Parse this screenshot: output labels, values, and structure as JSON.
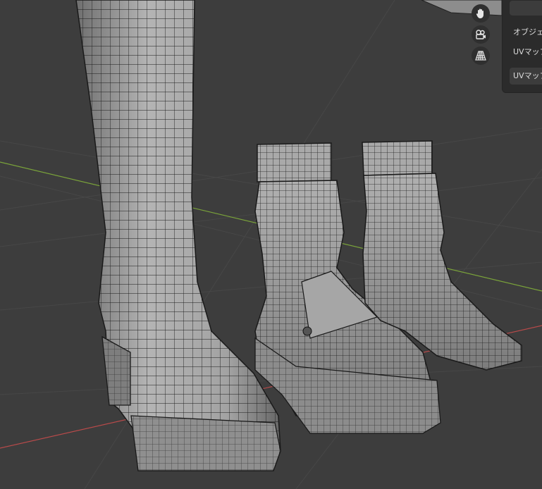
{
  "viewport": {
    "background": "#3d3d3d",
    "grid_color": "#474747",
    "x_axis_color": "#b84a4a",
    "y_axis_color": "#7aa33a",
    "mesh_fill": "#9c9c9c",
    "wire_color": "#1a1a1a"
  },
  "navigation": {
    "pan_icon": "hand-icon",
    "camera_icon": "camera-icon",
    "perspective_icon": "grid-icon"
  },
  "properties_panel": {
    "field_top": "",
    "object_label": "オブジェ",
    "uvmap_label_1": "UVマップ",
    "uvmap_label_2": "UVマップ"
  }
}
